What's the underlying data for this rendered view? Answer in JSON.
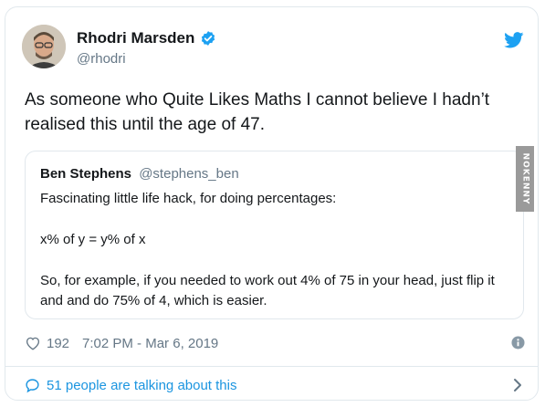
{
  "author": {
    "name": "Rhodri Marsden",
    "handle": "@rhodri",
    "avatar_icon": "avatar-photo",
    "verified_icon": "verified-badge-icon"
  },
  "tweet": {
    "text": "As someone who Quite Likes Maths I cannot believe I hadn’t realised this until the age of 47."
  },
  "quote": {
    "name": "Ben Stephens",
    "handle": "@stephens_ben",
    "line1": "Fascinating little life hack, for doing percentages:",
    "line2": "x% of y = y% of x",
    "line3": "So, for example, if you needed to work out 4% of 75 in your head, just flip it and and do 75% of 4, which is easier."
  },
  "meta": {
    "likes": "192",
    "timestamp": "7:02 PM - Mar 6, 2019"
  },
  "footer": {
    "talking": "51 people are talking about this"
  },
  "watermark": "NOKENNY",
  "colors": {
    "accent": "#1da1f2",
    "link": "#1b95e0",
    "muted": "#657786",
    "border": "#e1e8ed"
  }
}
